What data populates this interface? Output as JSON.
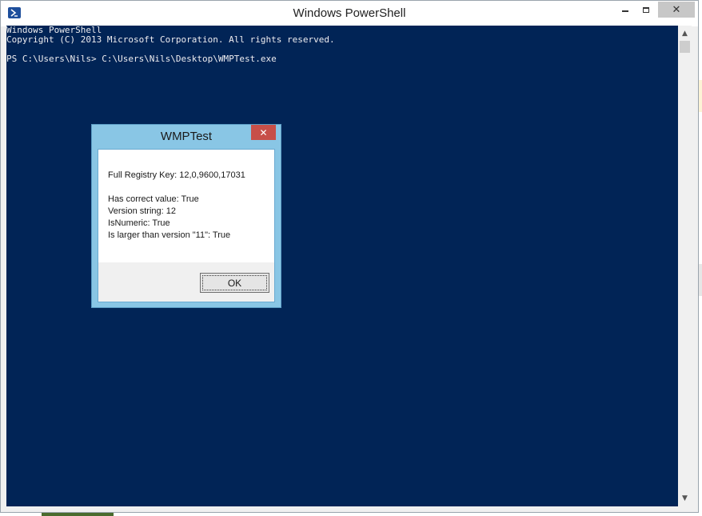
{
  "window": {
    "title": "Windows PowerShell",
    "icon": "powershell-icon",
    "controls": {
      "minimize_icon": "minimize-icon",
      "maximize_icon": "maximize-icon",
      "close_glyph": "✕"
    }
  },
  "console": {
    "lines": [
      "Windows PowerShell",
      "Copyright (C) 2013 Microsoft Corporation. All rights reserved.",
      "",
      "PS C:\\Users\\Nils> C:\\Users\\Nils\\Desktop\\WMPTest.exe"
    ],
    "colors": {
      "background": "#012456",
      "foreground": "#eeedf0"
    }
  },
  "scrollbar": {
    "up_glyph": "▲",
    "down_glyph": "▼"
  },
  "dialog": {
    "title": "WMPTest",
    "close_glyph": "✕",
    "message_lines": [
      "Full Registry Key: 12,0,9600,17031",
      "Has correct value: True",
      "Version string: 12",
      "IsNumeric: True",
      "Is larger than version \"11\": True"
    ],
    "ok_label": "OK",
    "colors": {
      "frame": "#89c6e5",
      "close_button": "#c74f48"
    }
  }
}
